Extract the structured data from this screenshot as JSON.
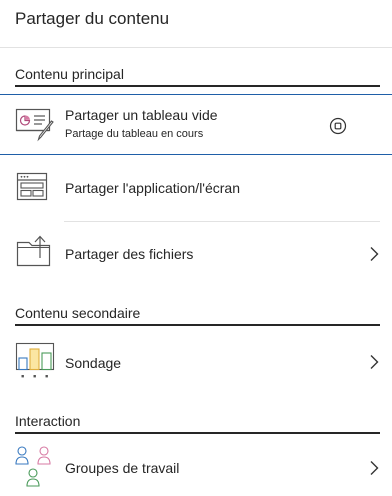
{
  "panel": {
    "title": "Partager du contenu"
  },
  "sections": {
    "primary": {
      "header": "Contenu principal",
      "items": [
        {
          "label": "Partager un tableau vide",
          "sublabel": "Partage du tableau en cours",
          "icon": "whiteboard-icon",
          "action_icon": "stop-share-icon"
        },
        {
          "label": "Partager l'application/l'écran",
          "icon": "screen-share-icon"
        },
        {
          "label": "Partager des fichiers",
          "icon": "folder-upload-icon",
          "action_icon": "chevron-right-icon"
        }
      ]
    },
    "secondary": {
      "header": "Contenu secondaire",
      "items": [
        {
          "label": "Sondage",
          "icon": "poll-chart-icon",
          "action_icon": "chevron-right-icon"
        }
      ]
    },
    "interaction": {
      "header": "Interaction",
      "items": [
        {
          "label": "Groupes de travail",
          "icon": "breakout-groups-icon",
          "action_icon": "chevron-right-icon"
        }
      ]
    }
  },
  "colors": {
    "active_border": "#1f5fa8",
    "text": "#262626",
    "divider": "#e2e2e2"
  }
}
